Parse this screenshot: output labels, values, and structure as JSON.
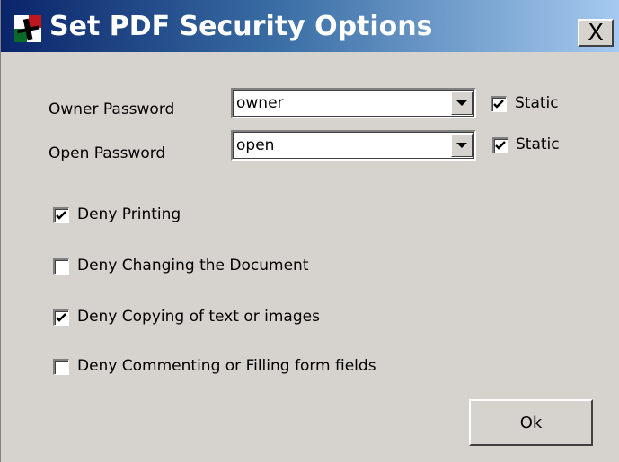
{
  "window": {
    "title": "Set PDF Security Options",
    "close_label": "X",
    "icon": "app-logo-icon"
  },
  "form": {
    "owner_password": {
      "label": "Owner Password",
      "value": "owner",
      "static_label": "Static",
      "static_checked": true
    },
    "open_password": {
      "label": "Open Password",
      "value": "open",
      "static_label": "Static",
      "static_checked": true
    },
    "options": [
      {
        "label": "Deny Printing",
        "checked": true
      },
      {
        "label": "Deny Changing the Document",
        "checked": false
      },
      {
        "label": "Deny Copying of text or images",
        "checked": true
      },
      {
        "label": "Deny Commenting or Filling form fields",
        "checked": false
      }
    ]
  },
  "actions": {
    "ok_label": "Ok"
  },
  "colors": {
    "titlebar_start": "#0a246a",
    "titlebar_end": "#a6caf0",
    "dialog_bg": "#d6d3ce"
  }
}
